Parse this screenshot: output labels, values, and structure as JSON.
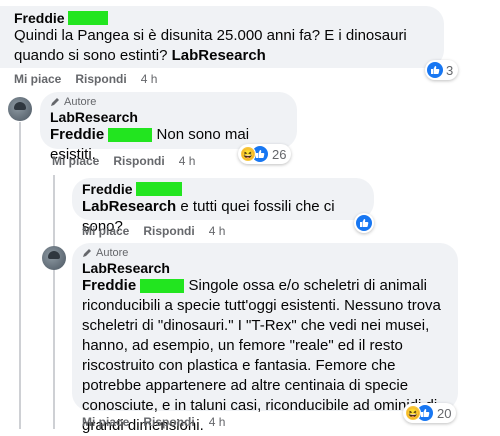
{
  "comment1": {
    "author": "Freddie",
    "text_a": "Quindi la Pangea si è disunita 25.000 anni fa? E i dinosauri quando si sono estinti?",
    "tag": "LabResearch",
    "reactions": "3"
  },
  "actions": {
    "like": "Mi piace",
    "reply": "Rispondi"
  },
  "comment2": {
    "role": "Autore",
    "author": "LabResearch",
    "mention": "Freddie",
    "text": "Non sono mai esistiti.",
    "reactions": "26",
    "time": "4 h"
  },
  "comment3": {
    "author": "Freddie",
    "mention": "LabResearch",
    "text": "e tutti quei fossili che ci sono?",
    "time": "4 h"
  },
  "comment4": {
    "role": "Autore",
    "author": "LabResearch",
    "mention": "Freddie",
    "text_first": "Singole ossa e/o scheletri di animali",
    "text_rest": "riconducibili a specie tutt'oggi esistenti. Nessuno trova scheletri di \"dinosauri.\" I \"T-Rex\" che vedi nei musei, hanno, ad esempio, un femore \"reale\" ed il resto riscostruito con plastica e fantasia. Femore che potrebbe appartenere ad altre centinaia di specie conosciute, e in taluni casi, riconducibile ad ominidi di grandi dimensioni.",
    "reactions": "20",
    "time": "4 h"
  },
  "comment1_time": "4 h"
}
